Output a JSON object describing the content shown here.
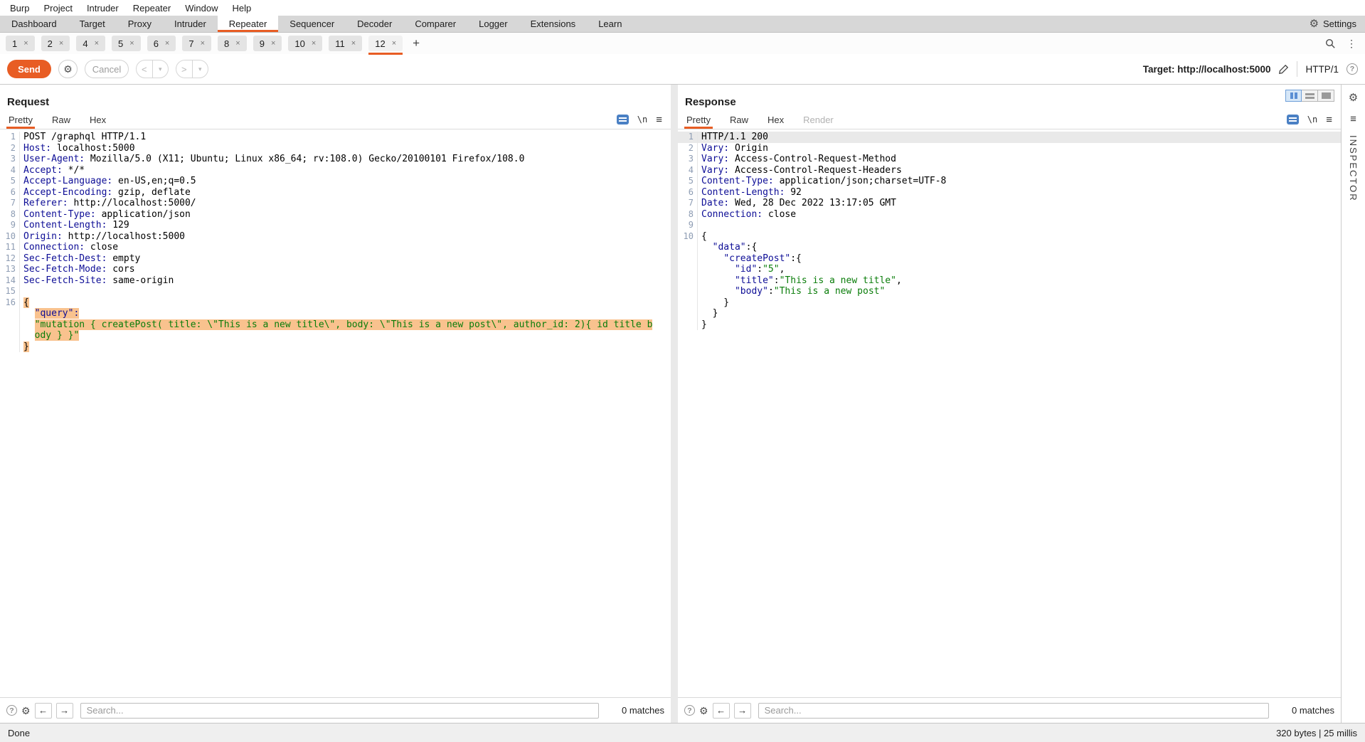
{
  "menubar": {
    "items": [
      "Burp",
      "Project",
      "Intruder",
      "Repeater",
      "Window",
      "Help"
    ]
  },
  "main_tabs": {
    "items": [
      "Dashboard",
      "Target",
      "Proxy",
      "Intruder",
      "Repeater",
      "Sequencer",
      "Decoder",
      "Comparer",
      "Logger",
      "Extensions",
      "Learn"
    ],
    "selected": "Repeater",
    "settings_label": "Settings"
  },
  "repeater_tabs": {
    "tabs": [
      "1",
      "2",
      "4",
      "5",
      "6",
      "7",
      "8",
      "9",
      "10",
      "11",
      "12"
    ],
    "selected": "12",
    "close_glyph": "×",
    "add_label": "+"
  },
  "toolbar": {
    "send_label": "Send",
    "cancel_label": "Cancel",
    "back_glyph": "<",
    "forward_glyph": ">",
    "dropdown_glyph": "▾",
    "target_label": "Target:",
    "target_value": "http://localhost:5000",
    "target_full": "Target: http://localhost:5000",
    "http_version": "HTTP/1"
  },
  "icons": {
    "gear": "⚙",
    "kebab": "⋮",
    "burger": "≡",
    "left_arrow": "←",
    "right_arrow": "→",
    "help": "?",
    "newline": "\\n"
  },
  "request_panel": {
    "title": "Request",
    "tabs": [
      {
        "label": "Pretty",
        "state": "selected"
      },
      {
        "label": "Raw",
        "state": ""
      },
      {
        "label": "Hex",
        "state": ""
      }
    ],
    "search_placeholder": "Search...",
    "matches_label": "0 matches",
    "lines": [
      {
        "n": "1",
        "seg": [
          {
            "t": "POST /graphql HTTP/1.1",
            "c": "p"
          }
        ]
      },
      {
        "n": "2",
        "seg": [
          {
            "t": "Host:",
            "c": "n"
          },
          {
            "t": " localhost:5000",
            "c": "p"
          }
        ]
      },
      {
        "n": "3",
        "seg": [
          {
            "t": "User-Agent:",
            "c": "n"
          },
          {
            "t": " Mozilla/5.0 (X11; Ubuntu; Linux x86_64; rv:108.0) Gecko/20100101 Firefox/108.0",
            "c": "p"
          }
        ]
      },
      {
        "n": "4",
        "seg": [
          {
            "t": "Accept:",
            "c": "n"
          },
          {
            "t": " */*",
            "c": "p"
          }
        ]
      },
      {
        "n": "5",
        "seg": [
          {
            "t": "Accept-Language:",
            "c": "n"
          },
          {
            "t": " en-US,en;q=0.5",
            "c": "p"
          }
        ]
      },
      {
        "n": "6",
        "seg": [
          {
            "t": "Accept-Encoding:",
            "c": "n"
          },
          {
            "t": " gzip, deflate",
            "c": "p"
          }
        ]
      },
      {
        "n": "7",
        "seg": [
          {
            "t": "Referer:",
            "c": "n"
          },
          {
            "t": " http://localhost:5000/",
            "c": "p"
          }
        ]
      },
      {
        "n": "8",
        "seg": [
          {
            "t": "Content-Type:",
            "c": "n"
          },
          {
            "t": " application/json",
            "c": "p"
          }
        ]
      },
      {
        "n": "9",
        "seg": [
          {
            "t": "Content-Length:",
            "c": "n"
          },
          {
            "t": " 129",
            "c": "p"
          }
        ]
      },
      {
        "n": "10",
        "seg": [
          {
            "t": "Origin:",
            "c": "n"
          },
          {
            "t": " http://localhost:5000",
            "c": "p"
          }
        ]
      },
      {
        "n": "11",
        "seg": [
          {
            "t": "Connection:",
            "c": "n"
          },
          {
            "t": " close",
            "c": "p"
          }
        ]
      },
      {
        "n": "12",
        "seg": [
          {
            "t": "Sec-Fetch-Dest:",
            "c": "n"
          },
          {
            "t": " empty",
            "c": "p"
          }
        ]
      },
      {
        "n": "13",
        "seg": [
          {
            "t": "Sec-Fetch-Mode:",
            "c": "n"
          },
          {
            "t": " cors",
            "c": "p"
          }
        ]
      },
      {
        "n": "14",
        "seg": [
          {
            "t": "Sec-Fetch-Site:",
            "c": "n"
          },
          {
            "t": " same-origin",
            "c": "p"
          }
        ]
      },
      {
        "n": "15",
        "seg": []
      },
      {
        "n": "16",
        "seg": [
          {
            "t": "{",
            "c": "p",
            "hl": true
          }
        ]
      },
      {
        "n": "",
        "seg": [
          {
            "t": "  ",
            "c": "p"
          },
          {
            "t": "\"query\":",
            "c": "n",
            "hl": true
          }
        ]
      },
      {
        "n": "",
        "seg": [
          {
            "t": "  ",
            "c": "p"
          },
          {
            "t": "\"mutation { createPost( title: \\\"This is a new title\\\", body: \\\"This is a new post\\\", author_id: 2){ id title b",
            "c": "s",
            "hl": true
          }
        ]
      },
      {
        "n": "",
        "seg": [
          {
            "t": "  ",
            "c": "p"
          },
          {
            "t": "ody } }\"",
            "c": "s",
            "hl": true
          }
        ]
      },
      {
        "n": "",
        "seg": [
          {
            "t": "}",
            "c": "p",
            "hl": true
          }
        ]
      }
    ]
  },
  "response_panel": {
    "title": "Response",
    "tabs": [
      {
        "label": "Pretty",
        "state": "selected"
      },
      {
        "label": "Raw",
        "state": ""
      },
      {
        "label": "Hex",
        "state": ""
      },
      {
        "label": "Render",
        "state": "disabled"
      }
    ],
    "search_placeholder": "Search...",
    "matches_label": "0 matches",
    "lines": [
      {
        "n": "1",
        "rowHl": true,
        "seg": [
          {
            "t": "HTTP/1.1 200",
            "c": "p"
          }
        ]
      },
      {
        "n": "2",
        "seg": [
          {
            "t": "Vary:",
            "c": "n"
          },
          {
            "t": " Origin",
            "c": "p"
          }
        ]
      },
      {
        "n": "3",
        "seg": [
          {
            "t": "Vary:",
            "c": "n"
          },
          {
            "t": " Access-Control-Request-Method",
            "c": "p"
          }
        ]
      },
      {
        "n": "4",
        "seg": [
          {
            "t": "Vary:",
            "c": "n"
          },
          {
            "t": " Access-Control-Request-Headers",
            "c": "p"
          }
        ]
      },
      {
        "n": "5",
        "seg": [
          {
            "t": "Content-Type:",
            "c": "n"
          },
          {
            "t": " application/json;charset=UTF-8",
            "c": "p"
          }
        ]
      },
      {
        "n": "6",
        "seg": [
          {
            "t": "Content-Length:",
            "c": "n"
          },
          {
            "t": " 92",
            "c": "p"
          }
        ]
      },
      {
        "n": "7",
        "seg": [
          {
            "t": "Date:",
            "c": "n"
          },
          {
            "t": " Wed, 28 Dec 2022 13:17:05 GMT",
            "c": "p"
          }
        ]
      },
      {
        "n": "8",
        "seg": [
          {
            "t": "Connection:",
            "c": "n"
          },
          {
            "t": " close",
            "c": "p"
          }
        ]
      },
      {
        "n": "9",
        "seg": []
      },
      {
        "n": "10",
        "seg": [
          {
            "t": "{",
            "c": "p"
          }
        ]
      },
      {
        "n": "",
        "seg": [
          {
            "t": "  ",
            "c": "p"
          },
          {
            "t": "\"data\"",
            "c": "n"
          },
          {
            "t": ":{",
            "c": "p"
          }
        ]
      },
      {
        "n": "",
        "seg": [
          {
            "t": "    ",
            "c": "p"
          },
          {
            "t": "\"createPost\"",
            "c": "n"
          },
          {
            "t": ":{",
            "c": "p"
          }
        ]
      },
      {
        "n": "",
        "seg": [
          {
            "t": "      ",
            "c": "p"
          },
          {
            "t": "\"id\"",
            "c": "n"
          },
          {
            "t": ":",
            "c": "p"
          },
          {
            "t": "\"5\"",
            "c": "s"
          },
          {
            "t": ",",
            "c": "p"
          }
        ]
      },
      {
        "n": "",
        "seg": [
          {
            "t": "      ",
            "c": "p"
          },
          {
            "t": "\"title\"",
            "c": "n"
          },
          {
            "t": ":",
            "c": "p"
          },
          {
            "t": "\"This is a new title\"",
            "c": "s"
          },
          {
            "t": ",",
            "c": "p"
          }
        ]
      },
      {
        "n": "",
        "seg": [
          {
            "t": "      ",
            "c": "p"
          },
          {
            "t": "\"body\"",
            "c": "n"
          },
          {
            "t": ":",
            "c": "p"
          },
          {
            "t": "\"This is a new post\"",
            "c": "s"
          }
        ]
      },
      {
        "n": "",
        "seg": [
          {
            "t": "    }",
            "c": "p"
          }
        ]
      },
      {
        "n": "",
        "seg": [
          {
            "t": "  }",
            "c": "p"
          }
        ]
      },
      {
        "n": "",
        "seg": [
          {
            "t": "}",
            "c": "p"
          }
        ]
      }
    ]
  },
  "inspector": {
    "label": "INSPECTOR"
  },
  "statusbar": {
    "left": "Done",
    "right": "320 bytes | 25 millis"
  },
  "colors": {
    "accent": "#e85d24",
    "header_name": "#0d0d96",
    "string_green": "#0a7d0a",
    "body_highlight": "#f9c28e",
    "row_highlight": "#e9e9e9"
  }
}
